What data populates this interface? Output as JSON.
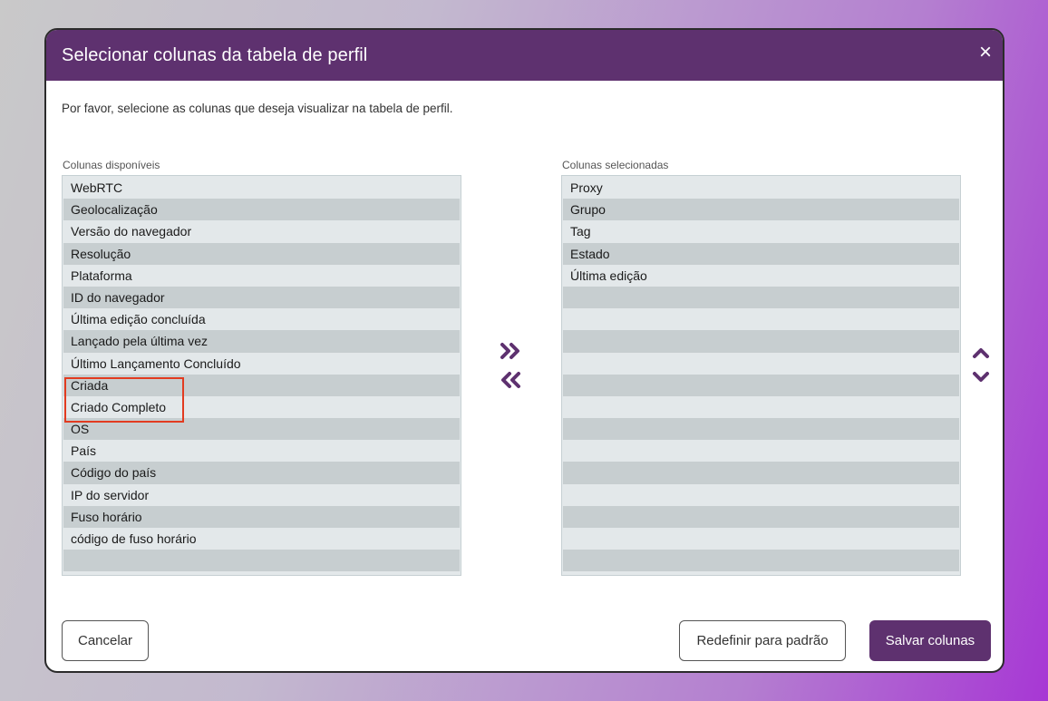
{
  "dialog": {
    "title": "Selecionar colunas da tabela de perfil",
    "close_icon": "×",
    "intro": "Por favor, selecione as colunas que deseja visualizar na tabela de perfil."
  },
  "available": {
    "label": "Colunas disponíveis",
    "items": [
      "WebRTC",
      "Geolocalização",
      "Versão do navegador",
      "Resolução",
      "Plataforma",
      "ID do navegador",
      "Última edição concluída",
      "Lançado pela última vez",
      "Último Lançamento Concluído",
      "Criada",
      "Criado Completo",
      "OS",
      "País",
      "Código do país",
      "IP do servidor",
      "Fuso horário",
      "código de fuso horário",
      ""
    ]
  },
  "selected": {
    "label": "Colunas selecionadas",
    "items": [
      "Proxy",
      "Grupo",
      "Tag",
      "Estado",
      "Última edição",
      "",
      "",
      "",
      "",
      "",
      "",
      "",
      "",
      "",
      "",
      "",
      "",
      ""
    ]
  },
  "icons": {
    "add": "double-chevron-right-icon",
    "remove": "double-chevron-left-icon",
    "move_up": "chevron-up-icon",
    "move_down": "chevron-down-icon"
  },
  "footer": {
    "cancel": "Cancelar",
    "reset": "Redefinir para padrão",
    "save": "Salvar colunas"
  },
  "colors": {
    "accent": "#5e316f",
    "highlight_border": "#e23b20"
  }
}
